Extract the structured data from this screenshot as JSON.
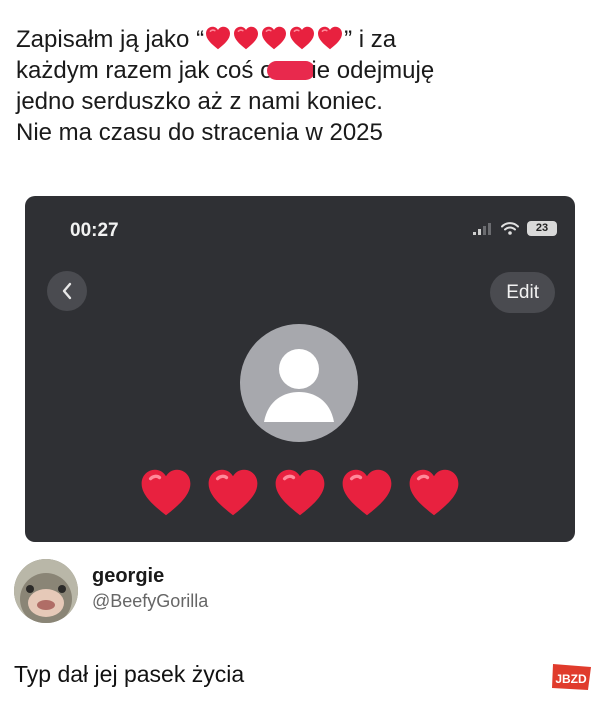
{
  "caption": {
    "line1_before": "Zapisałm ją jako “",
    "line1_after": "” i za",
    "line2_before": "każdym razem jak coś o",
    "line2_after": "ie odejmuję",
    "line3": "jedno serduszko aż z nami koniec.",
    "line4": "Nie ma czasu do stracenia w 2025"
  },
  "phone": {
    "time": "00:27",
    "battery": "23",
    "edit_label": "Edit",
    "heart_count": 5
  },
  "tweet": {
    "author_name": "georgie",
    "author_handle": "@BeefyGorilla",
    "text": "Typ dał jej pasek życia"
  },
  "watermark": "JBZD",
  "colors": {
    "heart": "#e8213f",
    "phone_bg": "#2f3034",
    "button_bg": "#4a4b50",
    "avatar_bg": "#a7a8ad"
  }
}
